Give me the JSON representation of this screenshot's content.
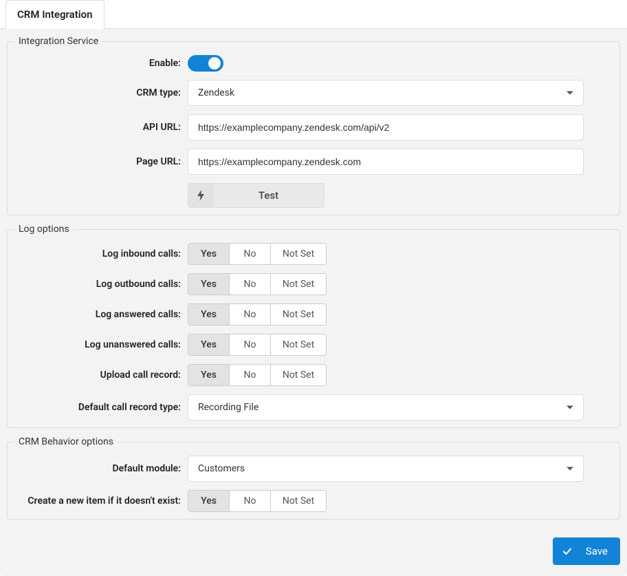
{
  "tab": {
    "label": "CRM Integration"
  },
  "integration": {
    "legend": "Integration Service",
    "enable_label": "Enable:",
    "crm_type_label": "CRM type:",
    "crm_type_value": "Zendesk",
    "api_url_label": "API URL:",
    "api_url_value": "https://examplecompany.zendesk.com/api/v2",
    "page_url_label": "Page URL:",
    "page_url_value": "https://examplecompany.zendesk.com",
    "test_label": "Test"
  },
  "log": {
    "legend": "Log options",
    "inbound_label": "Log inbound calls:",
    "outbound_label": "Log outbound calls:",
    "answered_label": "Log answered calls:",
    "unanswered_label": "Log unanswered calls:",
    "upload_label": "Upload call record:",
    "default_record_type_label": "Default call record type:",
    "default_record_type_value": "Recording File"
  },
  "behavior": {
    "legend": "CRM Behavior options",
    "default_module_label": "Default module:",
    "default_module_value": "Customers",
    "create_new_label": "Create a new item if it doesn't exist:"
  },
  "options": {
    "yes": "Yes",
    "no": "No",
    "not_set": "Not Set"
  },
  "footer": {
    "save_label": "Save"
  }
}
